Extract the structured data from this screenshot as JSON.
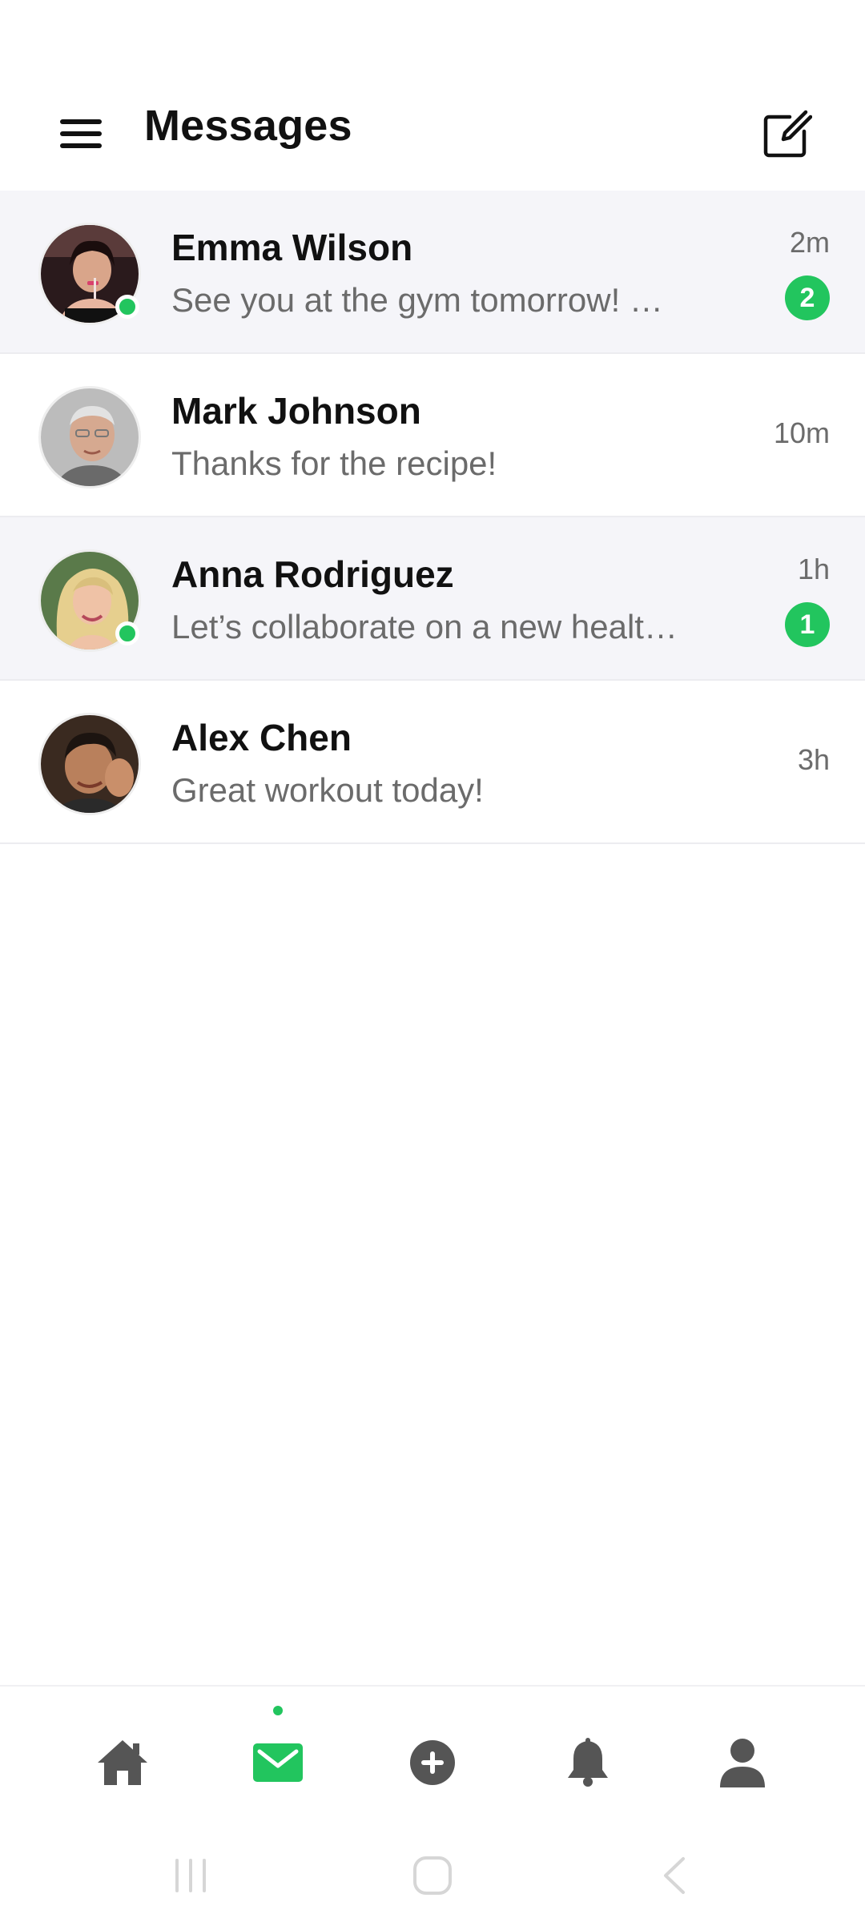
{
  "header": {
    "title": "Messages",
    "menu_icon": "hamburger-menu-icon",
    "compose_icon": "compose-icon"
  },
  "conversations": [
    {
      "name": "Emma Wilson",
      "preview": "See you at the gym tomorrow! …",
      "time": "2m",
      "unread_count": "2",
      "online": true,
      "highlighted": true
    },
    {
      "name": "Mark Johnson",
      "preview": "Thanks for the recipe!",
      "time": "10m",
      "unread_count": "",
      "online": false,
      "highlighted": false
    },
    {
      "name": "Anna Rodriguez",
      "preview": "Let’s collaborate on a new healt…",
      "time": "1h",
      "unread_count": "1",
      "online": true,
      "highlighted": true
    },
    {
      "name": "Alex Chen",
      "preview": "Great workout today!",
      "time": "3h",
      "unread_count": "",
      "online": false,
      "highlighted": false
    }
  ],
  "bottom_nav": {
    "items": [
      "home-icon",
      "mail-icon",
      "add-circle-icon",
      "bell-icon",
      "person-icon"
    ],
    "active": "mail-icon"
  },
  "colors": {
    "accent": "#22c55e",
    "highlight_row": "#f5f5f9",
    "muted_text": "#6b6b6b",
    "icon_gray": "#555555"
  }
}
